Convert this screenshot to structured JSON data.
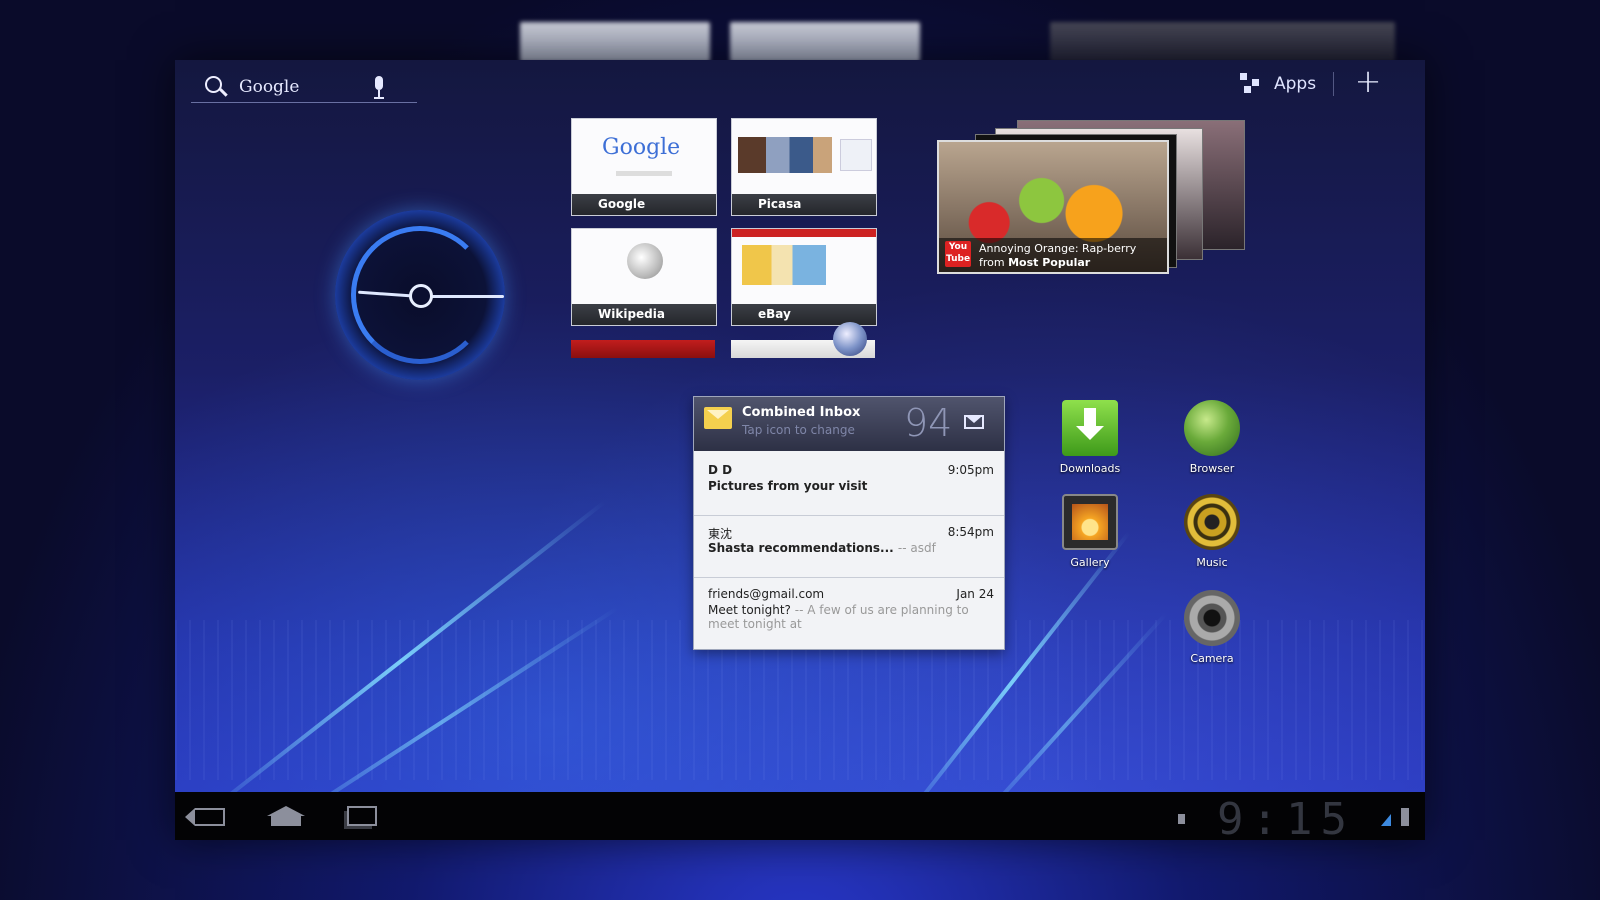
{
  "search": {
    "label": "Google"
  },
  "topbar": {
    "apps_label": "Apps",
    "add_label": "+"
  },
  "bookmarks": [
    {
      "label": "Google",
      "logo": "Google"
    },
    {
      "label": "Picasa"
    },
    {
      "label": "Wikipedia"
    },
    {
      "label": "eBay"
    }
  ],
  "youtube": {
    "title": "Annoying Orange: Rap-berry",
    "from_prefix": "from",
    "channel": "Most Popular",
    "logo": "You Tube"
  },
  "email": {
    "title": "Combined Inbox",
    "subtitle": "Tap icon to change",
    "count": "94",
    "messages": [
      {
        "from": "D D",
        "time": "9:05pm",
        "subject": "Pictures from your visit",
        "snippet": ""
      },
      {
        "from": "東沈",
        "time": "8:54pm",
        "subject": "Shasta recommendations...",
        "snippet": "asdf"
      },
      {
        "from": "friends@gmail.com",
        "time": "Jan 24",
        "subject": "Meet tonight?",
        "snippet": "A few of us are planning to meet tonight at"
      }
    ]
  },
  "apps": [
    {
      "label": "Downloads",
      "icon": "downloads-icon"
    },
    {
      "label": "Browser",
      "icon": "browser-icon"
    },
    {
      "label": "Gallery",
      "icon": "gallery-icon"
    },
    {
      "label": "Music",
      "icon": "music-icon"
    },
    {
      "label": "Camera",
      "icon": "camera-icon"
    }
  ],
  "systembar": {
    "time": "9:15"
  },
  "colors": {
    "accent": "#3a7cf2",
    "wallpaper": "#1b1f66",
    "sysbar": "#030305"
  }
}
